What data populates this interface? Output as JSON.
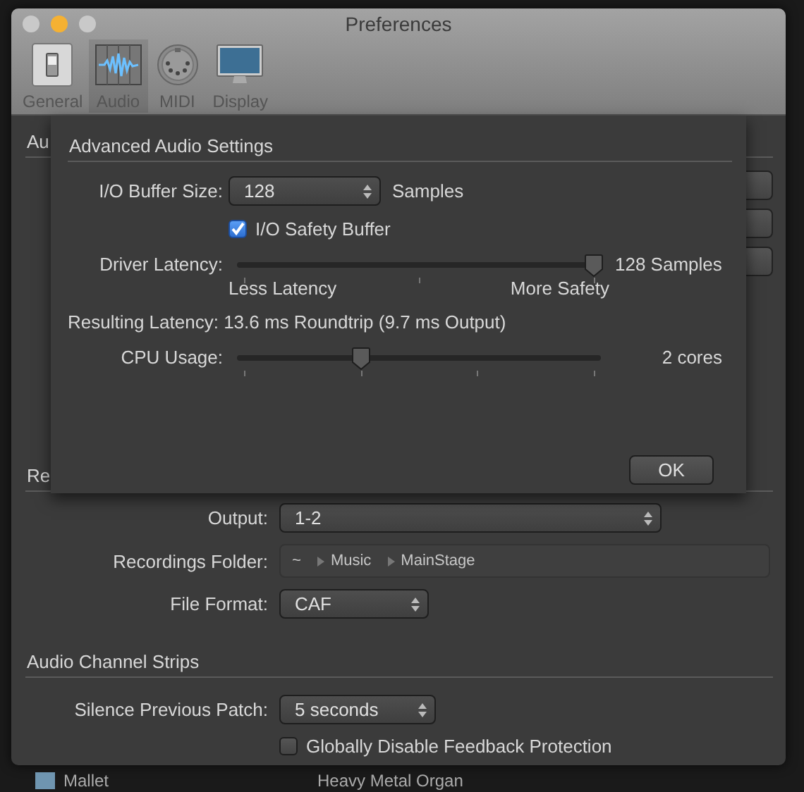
{
  "window": {
    "title": "Preferences",
    "window_buttons": [
      {
        "color": "#c9c9c9"
      },
      {
        "color": "#f5b133"
      },
      {
        "color": "#c9c9c9"
      }
    ]
  },
  "toolbar": [
    {
      "kind": "general",
      "label": "General",
      "selected": false
    },
    {
      "kind": "audio",
      "label": "Audio",
      "selected": true
    },
    {
      "kind": "midi",
      "label": "MIDI",
      "selected": false
    },
    {
      "kind": "display",
      "label": "Display",
      "selected": false
    }
  ],
  "audio_section": {
    "header": "Au"
  },
  "recording_section": {
    "header": "Re",
    "output": {
      "label": "Output:",
      "value": "1-2"
    },
    "folder": {
      "label": "Recordings Folder:",
      "path": [
        "~",
        "Music",
        "MainStage"
      ]
    },
    "file_format": {
      "label": "File Format:",
      "value": "CAF"
    }
  },
  "channel_strips": {
    "header": "Audio Channel Strips",
    "silence": {
      "label": "Silence Previous Patch:",
      "value": "5 seconds"
    },
    "feedback": {
      "label": "Globally Disable Feedback Protection",
      "checked": false
    }
  },
  "sheet": {
    "title": "Advanced Audio Settings",
    "buffer_size": {
      "label": "I/O Buffer Size:",
      "value": "128",
      "unit": "Samples"
    },
    "safety_buffer": {
      "label": "I/O Safety Buffer",
      "checked": true
    },
    "driver_latency": {
      "label": "Driver Latency:",
      "level": 1,
      "reading": "128 Samples",
      "min_label": "Less Latency",
      "max_label": "More Safety"
    },
    "resulting_latency": "Resulting Latency: 13.6 ms Roundtrip (9.7 ms Output)",
    "cpu_usage": {
      "label": "CPU Usage:",
      "level": 0.333,
      "reading": "2 cores"
    },
    "ok_button": "OK"
  },
  "background_list": [
    "Mallet",
    "Heavy Metal Organ"
  ]
}
